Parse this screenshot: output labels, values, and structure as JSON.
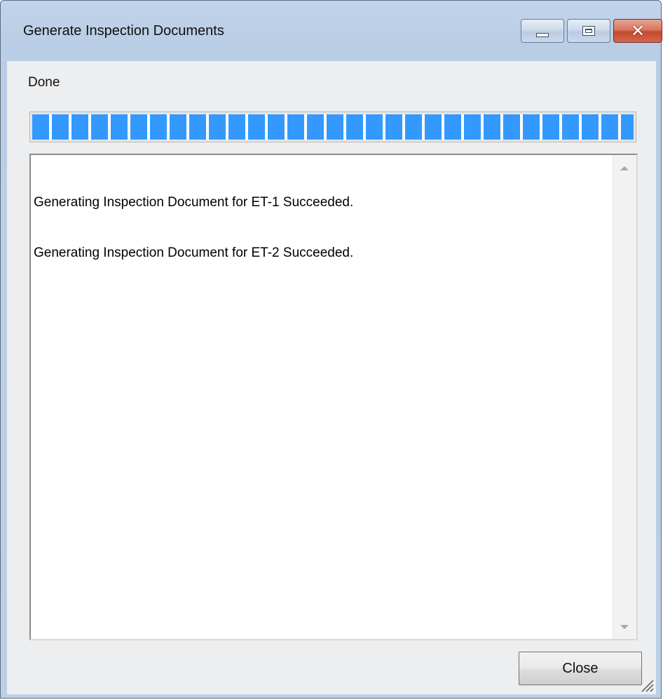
{
  "window": {
    "title": "Generate Inspection Documents",
    "minimize_icon": "minimize-icon",
    "maximize_icon": "maximize-icon",
    "close_icon": "close-icon"
  },
  "status": {
    "text": "Done"
  },
  "progress": {
    "value_percent": 100,
    "color": "#3399ff"
  },
  "log": {
    "lines": [
      "Generating Inspection Document for ET-1 Succeeded.",
      "Generating Inspection Document for ET-2 Succeeded."
    ]
  },
  "footer": {
    "close_label": "Close"
  }
}
